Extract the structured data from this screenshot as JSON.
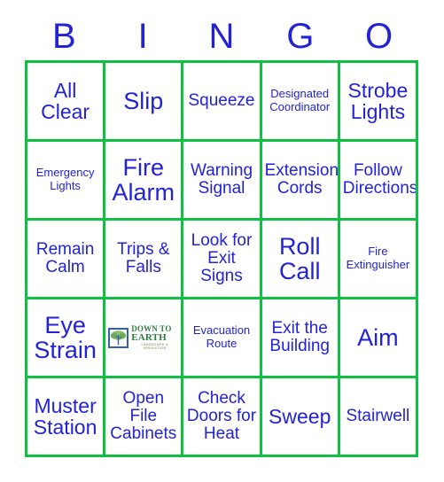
{
  "header": {
    "letters": [
      "B",
      "I",
      "N",
      "G",
      "O"
    ]
  },
  "colors": {
    "grid_green": "#10c040",
    "text_blue": "#2222d8",
    "background": "#ffffff",
    "logo_green": "#2f7d3f",
    "logo_blue": "#3a5fa8"
  },
  "logo": {
    "name": "down-to-earth-logo",
    "word1": "DOWN TO",
    "word2": "EARTH",
    "tagline": "LANDSCAPE & IRRIGATION",
    "icon": "tree-icon"
  },
  "grid": {
    "rows": 5,
    "columns": 5,
    "cells": [
      [
        {
          "text": "All Clear",
          "size": "lg"
        },
        {
          "text": "Slip",
          "size": "xl"
        },
        {
          "text": "Squeeze",
          "size": "md"
        },
        {
          "text": "Designated Coordinator",
          "size": "sm"
        },
        {
          "text": "Strobe Lights",
          "size": "lg"
        }
      ],
      [
        {
          "text": "Emergency Lights",
          "size": "sm"
        },
        {
          "text": "Fire Alarm",
          "size": "xl"
        },
        {
          "text": "Warning Signal",
          "size": "md"
        },
        {
          "text": "Extension Cords",
          "size": "md"
        },
        {
          "text": "Follow Directions",
          "size": "md"
        }
      ],
      [
        {
          "text": "Remain Calm",
          "size": "md"
        },
        {
          "text": "Trips & Falls",
          "size": "md"
        },
        {
          "text": "Look for Exit Signs",
          "size": "md"
        },
        {
          "text": "Roll Call",
          "size": "xl"
        },
        {
          "text": "Fire Extinguisher",
          "size": "sm"
        }
      ],
      [
        {
          "text": "Eye Strain",
          "size": "xl"
        },
        {
          "text": "",
          "size": "md",
          "is_logo": true
        },
        {
          "text": "Evacuation Route",
          "size": "sm"
        },
        {
          "text": "Exit the Building",
          "size": "md"
        },
        {
          "text": "Aim",
          "size": "xl"
        }
      ],
      [
        {
          "text": "Muster Station",
          "size": "lg"
        },
        {
          "text": "Open File Cabinets",
          "size": "md"
        },
        {
          "text": "Check Doors for Heat",
          "size": "md"
        },
        {
          "text": "Sweep",
          "size": "lg"
        },
        {
          "text": "Stairwell",
          "size": "md"
        }
      ]
    ]
  }
}
